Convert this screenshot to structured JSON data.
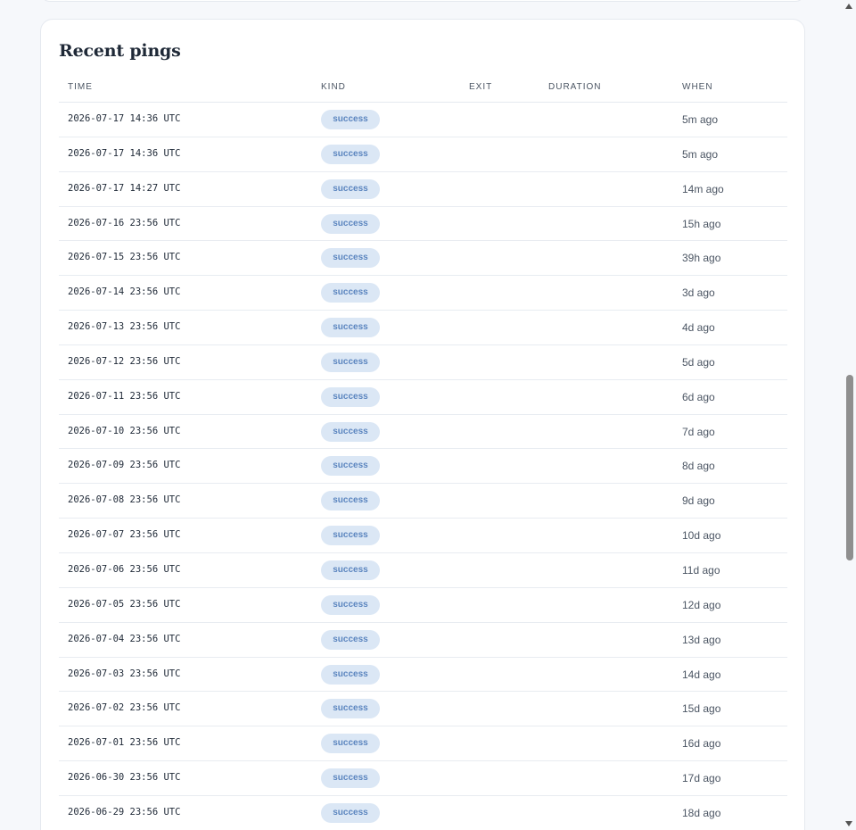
{
  "section": {
    "title": "Recent pings"
  },
  "table": {
    "headers": {
      "time": "TIME",
      "kind": "KIND",
      "exit": "EXIT",
      "duration": "DURATION",
      "when": "WHEN"
    },
    "rows": [
      {
        "time": "2026-07-17 14:36 UTC",
        "kind": "success",
        "exit": "",
        "duration": "",
        "when": "5m ago"
      },
      {
        "time": "2026-07-17 14:36 UTC",
        "kind": "success",
        "exit": "",
        "duration": "",
        "when": "5m ago"
      },
      {
        "time": "2026-07-17 14:27 UTC",
        "kind": "success",
        "exit": "",
        "duration": "",
        "when": "14m ago"
      },
      {
        "time": "2026-07-16 23:56 UTC",
        "kind": "success",
        "exit": "",
        "duration": "",
        "when": "15h ago"
      },
      {
        "time": "2026-07-15 23:56 UTC",
        "kind": "success",
        "exit": "",
        "duration": "",
        "when": "39h ago"
      },
      {
        "time": "2026-07-14 23:56 UTC",
        "kind": "success",
        "exit": "",
        "duration": "",
        "when": "3d ago"
      },
      {
        "time": "2026-07-13 23:56 UTC",
        "kind": "success",
        "exit": "",
        "duration": "",
        "when": "4d ago"
      },
      {
        "time": "2026-07-12 23:56 UTC",
        "kind": "success",
        "exit": "",
        "duration": "",
        "when": "5d ago"
      },
      {
        "time": "2026-07-11 23:56 UTC",
        "kind": "success",
        "exit": "",
        "duration": "",
        "when": "6d ago"
      },
      {
        "time": "2026-07-10 23:56 UTC",
        "kind": "success",
        "exit": "",
        "duration": "",
        "when": "7d ago"
      },
      {
        "time": "2026-07-09 23:56 UTC",
        "kind": "success",
        "exit": "",
        "duration": "",
        "when": "8d ago"
      },
      {
        "time": "2026-07-08 23:56 UTC",
        "kind": "success",
        "exit": "",
        "duration": "",
        "when": "9d ago"
      },
      {
        "time": "2026-07-07 23:56 UTC",
        "kind": "success",
        "exit": "",
        "duration": "",
        "when": "10d ago"
      },
      {
        "time": "2026-07-06 23:56 UTC",
        "kind": "success",
        "exit": "",
        "duration": "",
        "when": "11d ago"
      },
      {
        "time": "2026-07-05 23:56 UTC",
        "kind": "success",
        "exit": "",
        "duration": "",
        "when": "12d ago"
      },
      {
        "time": "2026-07-04 23:56 UTC",
        "kind": "success",
        "exit": "",
        "duration": "",
        "when": "13d ago"
      },
      {
        "time": "2026-07-03 23:56 UTC",
        "kind": "success",
        "exit": "",
        "duration": "",
        "when": "14d ago"
      },
      {
        "time": "2026-07-02 23:56 UTC",
        "kind": "success",
        "exit": "",
        "duration": "",
        "when": "15d ago"
      },
      {
        "time": "2026-07-01 23:56 UTC",
        "kind": "success",
        "exit": "",
        "duration": "",
        "when": "16d ago"
      },
      {
        "time": "2026-06-30 23:56 UTC",
        "kind": "success",
        "exit": "",
        "duration": "",
        "when": "17d ago"
      },
      {
        "time": "2026-06-29 23:56 UTC",
        "kind": "success",
        "exit": "",
        "duration": "",
        "when": "18d ago"
      }
    ]
  },
  "colors": {
    "badge_bg": "#dbe7f5",
    "badge_text": "#5b85bf",
    "card_bg": "#ffffff",
    "page_bg": "#f6f8fb"
  },
  "icons": {
    "scroll_up": "scroll-up-arrow-icon",
    "scroll_down": "scroll-down-arrow-icon"
  }
}
